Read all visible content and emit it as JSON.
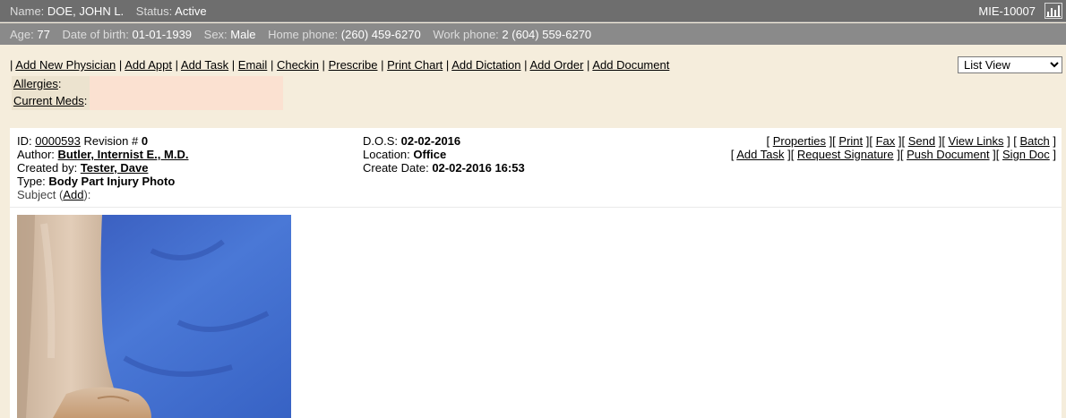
{
  "patient": {
    "name_label": "Name:",
    "name": "DOE, JOHN L.",
    "status_label": "Status:",
    "status": "Active",
    "mrn": "MIE-10007",
    "age_label": "Age:",
    "age": "77",
    "dob_label": "Date of birth:",
    "dob": "01-01-1939",
    "sex_label": "Sex:",
    "sex": "Male",
    "home_phone_label": "Home phone:",
    "home_phone": "(260) 459-6270",
    "work_phone_label": "Work phone:",
    "work_phone": "2 (604) 559-6270"
  },
  "actions": [
    "Add New Physician",
    "Add Appt",
    "Add Task",
    "Email",
    "Checkin",
    "Prescribe",
    "Print Chart",
    "Add Dictation",
    "Add Order",
    "Add Document"
  ],
  "view_select": {
    "selected": "List View"
  },
  "info": {
    "allergies_label": "Allergies",
    "meds_label": "Current Meds"
  },
  "document": {
    "id_label": "ID:",
    "id": "0000593",
    "revision_label": "Revision #",
    "revision": "0",
    "author_label": "Author:",
    "author": "Butler, Internist E., M.D.",
    "created_by_label": "Created by:",
    "created_by": "Tester, Dave",
    "type_label": "Type:",
    "type": "Body Part Injury Photo",
    "subject_label": "Subject (",
    "subject_add": "Add",
    "subject_suffix": "):",
    "dos_label": "D.O.S:",
    "dos": "02-02-2016",
    "location_label": "Location:",
    "location": "Office",
    "create_date_label": "Create Date:",
    "create_date": "02-02-2016 16:53",
    "links_row1": [
      "Properties",
      "Print",
      "Fax",
      "Send",
      "View Links",
      "Batch"
    ],
    "links_row2": [
      "Add Task",
      "Request Signature",
      "Push Document",
      "Sign Doc"
    ]
  },
  "icons": {
    "chart": "bar-chart-icon"
  },
  "colors": {
    "header_dark": "#6e6e6e",
    "header_light": "#8a8a8a",
    "page_bg": "#f5eddc",
    "meds_bg": "#fbe1d1"
  }
}
